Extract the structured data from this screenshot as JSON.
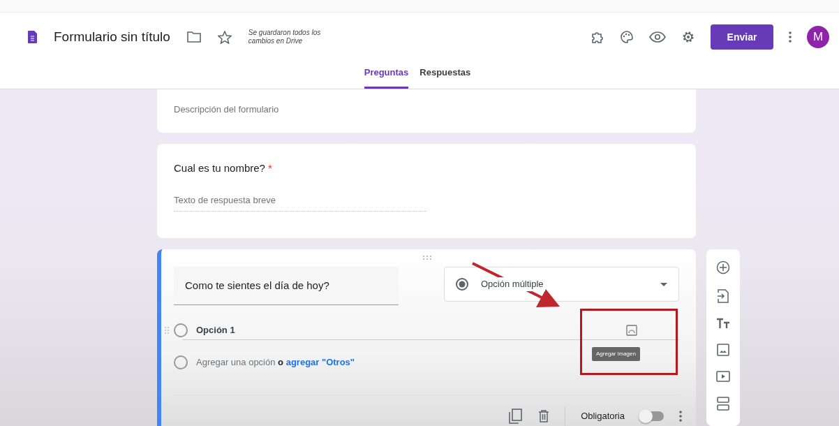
{
  "header": {
    "title": "Formulario sin título",
    "save_status": "Se guardaron todos los cambios en Drive",
    "send_button": "Enviar",
    "avatar": "M"
  },
  "tabs": [
    {
      "label": "Preguntas",
      "selected": true
    },
    {
      "label": "Respuestas",
      "selected": false
    }
  ],
  "description_placeholder": "Descripción del formulario",
  "short_question": {
    "title": "Cual es tu nombre?",
    "required_mark": "*",
    "answer_placeholder": "Texto de respuesta breve"
  },
  "active_question": {
    "title": "Como te sientes el día de hoy?",
    "type": "Opción múltiple",
    "options": [
      {
        "label": "Opción 1",
        "selected": false
      }
    ],
    "add_option_selected": false,
    "add_option": "Agregar una opción",
    "separator": "o",
    "add_other": "agregar \"Otros\"",
    "tooltip": "Agregar imagen",
    "required_label": "Obligatoria",
    "required_on": false
  }
}
